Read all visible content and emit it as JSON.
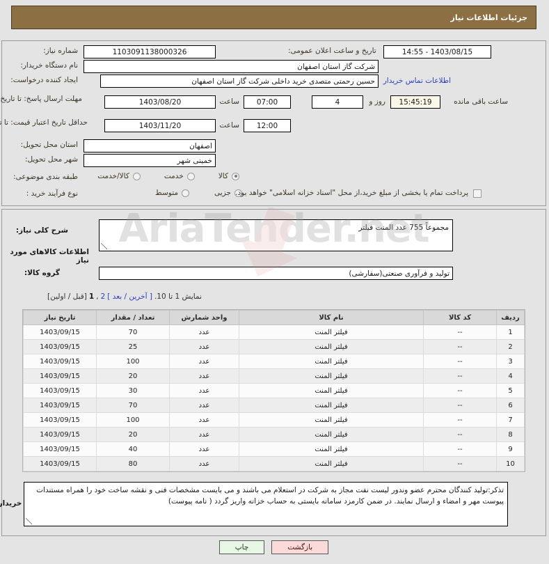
{
  "header": {
    "title": "جزئیات اطلاعات نیاز"
  },
  "form": {
    "need_number_label": "شماره نیاز:",
    "need_number_value": "1103091138000326",
    "announce_label": "تاریخ و ساعت اعلان عمومی:",
    "announce_value": "1403/08/15 - 14:55",
    "buyer_org_label": "نام دستگاه خریدار:",
    "buyer_org_value": "شرکت گاز استان اصفهان",
    "requester_label": "ایجاد کننده درخواست:",
    "requester_value": "حسین  رحمتی متصدی خرید داخلی شرکت گاز استان اصفهان",
    "contact_link": "اطلاعات تماس خریدار",
    "deadline_label": "مهلت ارسال پاسخ: تا تاریخ:",
    "deadline_date": "1403/08/20",
    "hour_label": "ساعت",
    "deadline_hour": "07:00",
    "days_value": "4",
    "days_label": "روز و",
    "time_remaining": "15:45:19",
    "remaining_label": "ساعت باقی مانده",
    "validity_label": "حداقل تاریخ اعتبار قیمت: تا تاریخ:",
    "validity_date": "1403/11/20",
    "validity_hour": "12:00",
    "province_label": "استان محل تحویل:",
    "province_value": "اصفهان",
    "city_label": "شهر محل تحویل:",
    "city_value": "خمینی شهر",
    "classification_label": "طبقه بندی موضوعی:",
    "classification_options": [
      {
        "label": "کالا",
        "selected": true
      },
      {
        "label": "خدمت",
        "selected": false
      },
      {
        "label": "کالا/خدمت",
        "selected": false
      }
    ],
    "process_label": "نوع فرآیند خرید :",
    "process_options": [
      {
        "label": "جزیی",
        "selected": false
      },
      {
        "label": "متوسط",
        "selected": false
      }
    ],
    "treasury_checkbox_label": "پرداخت تمام یا بخشی از مبلغ خرید،از محل \"اسناد خزانه اسلامی\" خواهد بود.",
    "treasury_checked": false
  },
  "summary": {
    "label": "شرح کلی نیاز:",
    "value": "مجموعاً 755 عدد المنت فیلتر"
  },
  "goods_section": {
    "heading": "اطلاعات کالاهای مورد نیاز",
    "group_label": "گروه کالا:",
    "group_value": "تولید و فرآوری صنعتی(سفارشی)"
  },
  "pagination": {
    "showing": "نمایش 1 تا 10.",
    "last_next": "[ آخرین / بعد ]",
    "page_current": "1",
    "page_other": "2",
    "comma": ",",
    "prev_first": "[قبل / اولین]"
  },
  "table": {
    "columns": [
      "ردیف",
      "کد کالا",
      "نام کالا",
      "واحد شمارش",
      "تعداد / مقدار",
      "تاریخ نیاز"
    ],
    "rows": [
      {
        "row": "1",
        "code": "--",
        "name": "فیلتر المنت",
        "unit": "عدد",
        "qty": "70",
        "date": "1403/09/15"
      },
      {
        "row": "2",
        "code": "--",
        "name": "فیلتر المنت",
        "unit": "عدد",
        "qty": "25",
        "date": "1403/09/15"
      },
      {
        "row": "3",
        "code": "--",
        "name": "فیلتر المنت",
        "unit": "عدد",
        "qty": "100",
        "date": "1403/09/15"
      },
      {
        "row": "4",
        "code": "--",
        "name": "فیلتر المنت",
        "unit": "عدد",
        "qty": "20",
        "date": "1403/09/15"
      },
      {
        "row": "5",
        "code": "--",
        "name": "فیلتر المنت",
        "unit": "عدد",
        "qty": "30",
        "date": "1403/09/15"
      },
      {
        "row": "6",
        "code": "--",
        "name": "فیلتر المنت",
        "unit": "عدد",
        "qty": "70",
        "date": "1403/09/15"
      },
      {
        "row": "7",
        "code": "--",
        "name": "فیلتر المنت",
        "unit": "عدد",
        "qty": "100",
        "date": "1403/09/15"
      },
      {
        "row": "8",
        "code": "--",
        "name": "فیلتر المنت",
        "unit": "عدد",
        "qty": "20",
        "date": "1403/09/15"
      },
      {
        "row": "9",
        "code": "--",
        "name": "فیلتر المنت",
        "unit": "عدد",
        "qty": "40",
        "date": "1403/09/15"
      },
      {
        "row": "10",
        "code": "--",
        "name": "فیلتر المنت",
        "unit": "عدد",
        "qty": "80",
        "date": "1403/09/15"
      }
    ]
  },
  "notes": {
    "label": "توضیحات خریدار:",
    "value": "تذکر:تولید کنندگان محترم عضو وندور لیست نفت مجاز به شرکت در استعلام می باشند و می بایست مشخصات فنی و نقشه ساخت خود را همراه مستندات پیوست مهر و امضاء و ارسال نمایند. در ضمن کارمزد سامانه بایستی به حساب خزانه واریز گردد ( نامه پیوست)"
  },
  "buttons": {
    "print": "چاپ",
    "back": "بازگشت"
  },
  "watermark": {
    "text": "AriaTender.net"
  }
}
